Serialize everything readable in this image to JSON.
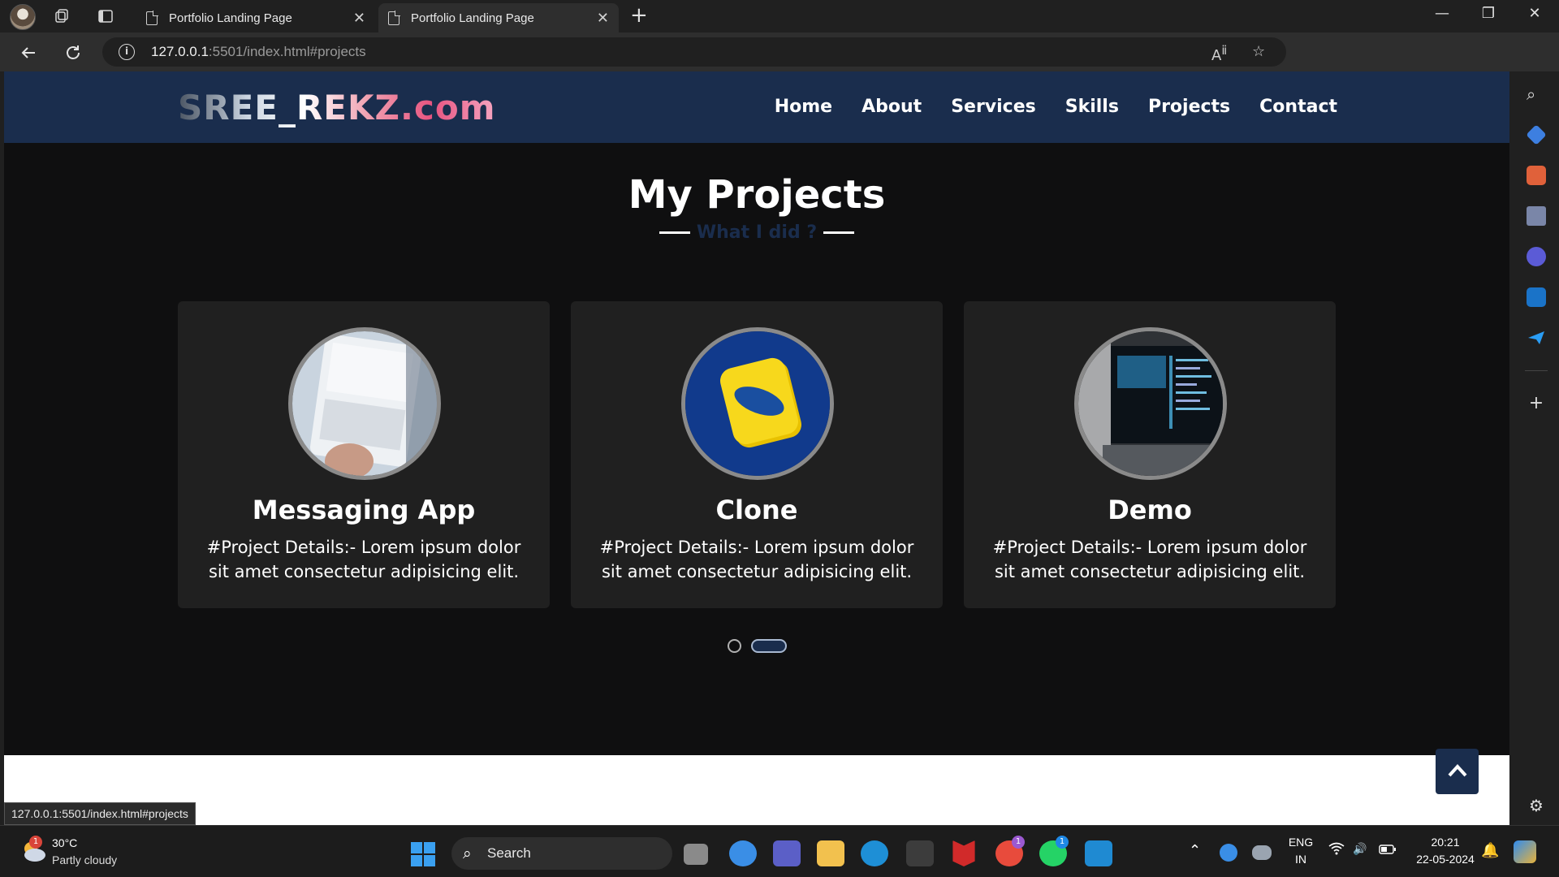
{
  "browser": {
    "tabs": [
      {
        "title": "Portfolio Landing Page"
      },
      {
        "title": "Portfolio Landing Page"
      }
    ],
    "url_host": "127.0.0.1",
    "url_rest": ":5501/index.html#projects",
    "status_url": "127.0.0.1:5501/index.html#projects"
  },
  "site": {
    "logo": "SREE_REKZ.com",
    "nav": [
      "Home",
      "About",
      "Services",
      "Skills",
      "Projects",
      "Contact"
    ],
    "section_title": "My Projects",
    "section_subtitle": "What I did ?",
    "projects": [
      {
        "title": "Messaging App",
        "details": "#Project Details:- Lorem ipsum dolor sit amet consectetur adipisicing elit."
      },
      {
        "title": "Clone",
        "details": "#Project Details:- Lorem ipsum dolor sit amet consectetur adipisicing elit."
      },
      {
        "title": "Demo",
        "details": "#Project Details:- Lorem ipsum dolor sit amet consectetur adipisicing elit."
      }
    ],
    "carousel": {
      "pages": 2,
      "active_page": 2
    },
    "colors": {
      "header_bg": "#1a2d4d",
      "page_bg": "#0f0f10",
      "card_bg": "#202020"
    }
  },
  "taskbar": {
    "weather_temp": "30°C",
    "weather_desc": "Partly cloudy",
    "weather_badge": "1",
    "search_label": "Search",
    "lang_top": "ENG",
    "lang_bottom": "IN",
    "time": "20:21",
    "date": "22-05-2024",
    "teams_badge": "1",
    "whatsapp_badge": "1"
  }
}
